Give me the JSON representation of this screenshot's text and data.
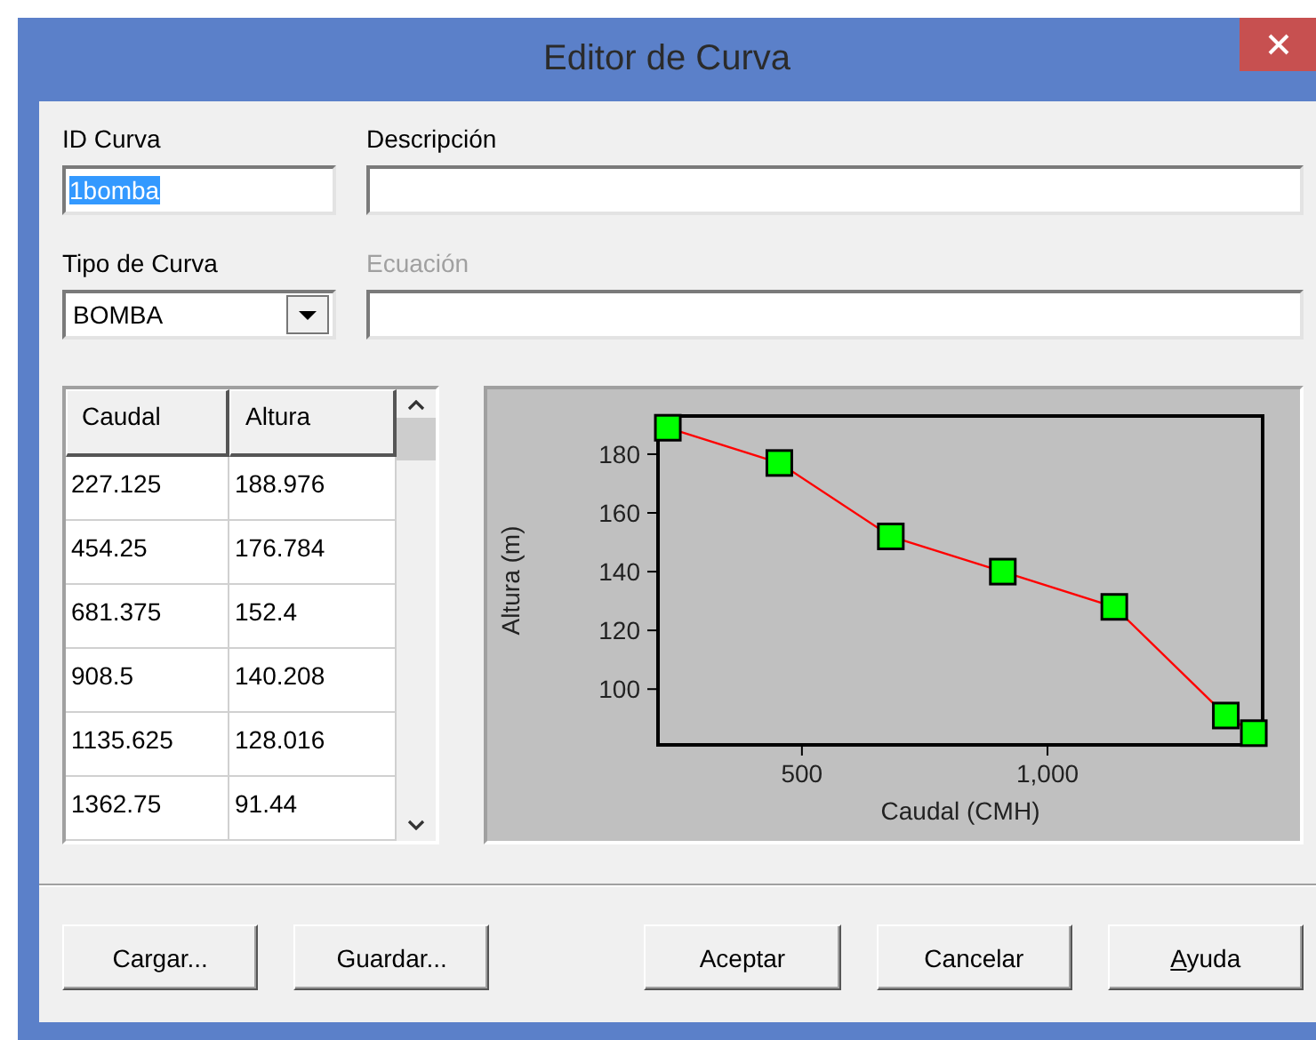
{
  "window": {
    "title": "Editor de Curva"
  },
  "id_field": {
    "label": "ID Curva",
    "value": "1bomba",
    "text_selected": true
  },
  "description_field": {
    "label": "Descripción"
  },
  "type_field": {
    "label": "Tipo de Curva",
    "value": "BOMBA"
  },
  "equation_field": {
    "label": "Ecuación",
    "disabled": true
  },
  "table": {
    "columns": [
      "Caudal",
      "Altura"
    ],
    "rows": [
      [
        "227.125",
        "188.976"
      ],
      [
        "454.25",
        "176.784"
      ],
      [
        "681.375",
        "152.4"
      ],
      [
        "908.5",
        "140.208"
      ],
      [
        "1135.625",
        "128.016"
      ],
      [
        "1362.75",
        "91.44"
      ]
    ]
  },
  "chart": {
    "chart_data": {
      "type": "line",
      "xlabel": "Caudal (CMH)",
      "ylabel": "Altura (m)",
      "x": [
        227,
        454,
        681,
        909,
        1136,
        1363,
        1420
      ],
      "series": [
        {
          "color": "#ff0000",
          "marker": "square",
          "values": [
            189,
            177,
            152,
            140,
            128,
            91,
            85
          ]
        }
      ],
      "xlim": [
        207,
        1438
      ],
      "ylim": [
        81,
        193
      ],
      "xticks": [
        500,
        {
          "value": 1000,
          "label": "1,000"
        }
      ],
      "yticks": [
        100,
        120,
        140,
        160,
        180
      ]
    }
  },
  "file_buttons": [
    {
      "label": "Cargar...",
      "mnemonic": false
    },
    {
      "label": "Guardar...",
      "mnemonic": false
    }
  ],
  "dialog_buttons": [
    {
      "label": "Aceptar",
      "mnemonic": false
    },
    {
      "label": "Cancelar",
      "mnemonic": false
    },
    {
      "label": "Ayuda",
      "mnemonic": true
    }
  ]
}
